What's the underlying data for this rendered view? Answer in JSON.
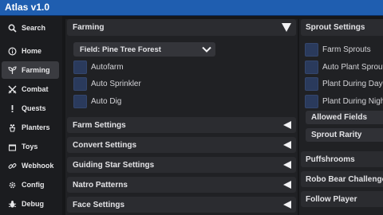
{
  "window": {
    "title": "Atlas v1.0"
  },
  "sidebar": {
    "items": [
      {
        "label": "Search",
        "icon": "search-icon"
      },
      {
        "label": "Home",
        "icon": "info-icon"
      },
      {
        "label": "Farming",
        "icon": "seedling-icon",
        "active": true
      },
      {
        "label": "Combat",
        "icon": "swords-icon"
      },
      {
        "label": "Quests",
        "icon": "exclamation-icon"
      },
      {
        "label": "Planters",
        "icon": "flowerpot-icon"
      },
      {
        "label": "Toys",
        "icon": "toybox-icon"
      },
      {
        "label": "Webhook",
        "icon": "link-icon"
      },
      {
        "label": "Config",
        "icon": "gear-icon"
      },
      {
        "label": "Debug",
        "icon": "bug-icon"
      }
    ]
  },
  "farming": {
    "header": "Farming",
    "field_dropdown": "Field: Pine Tree Forest",
    "toggles": [
      "Autofarm",
      "Auto Sprinkler",
      "Auto Dig"
    ],
    "sections": [
      "Farm Settings",
      "Convert Settings",
      "Guiding Star Settings",
      "Natro Patterns",
      "Face Settings"
    ]
  },
  "sprout": {
    "header": "Sprout Settings",
    "toggles": [
      "Farm Sprouts",
      "Auto Plant Sprouts",
      "Plant During Day",
      "Plant During Night"
    ],
    "subsections": [
      "Allowed Fields",
      "Sprout Rarity"
    ],
    "sections": [
      "Puffshrooms",
      "Robo Bear Challenge",
      "Follow Player"
    ]
  },
  "colors": {
    "titlebar": "#1f5eb0",
    "toggle_off": "#2a3a5c"
  }
}
